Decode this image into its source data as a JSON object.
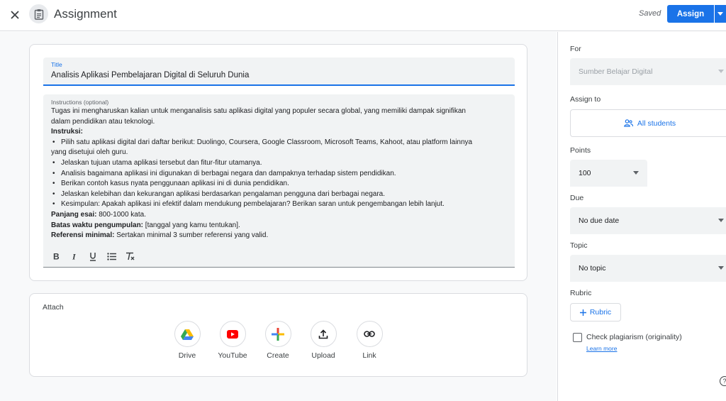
{
  "header": {
    "title": "Assignment",
    "saved_text": "Saved",
    "assign_label": "Assign"
  },
  "form": {
    "title_label": "Title",
    "title_value": "Analisis Aplikasi Pembelajaran Digital di Seluruh Dunia",
    "instructions_label": "Instructions (optional)",
    "intro_line1": "Tugas ini mengharuskan kalian untuk menganalisis satu aplikasi digital yang populer secara global, yang memiliki dampak signifikan",
    "intro_line2": "dalam pendidikan atau teknologi.",
    "instruksi_heading": "Instruksi:",
    "bullets": [
      "Pilih satu aplikasi digital dari daftar berikut: Duolingo, Coursera, Google Classroom, Microsoft Teams, Kahoot, atau platform lainnya",
      "yang disetujui oleh guru.",
      "Jelaskan tujuan utama aplikasi tersebut dan fitur-fitur utamanya.",
      "Analisis bagaimana aplikasi ini digunakan di berbagai negara dan dampaknya terhadap sistem pendidikan.",
      "Berikan contoh kasus nyata penggunaan aplikasi ini di dunia pendidikan.",
      "Jelaskan kelebihan dan kekurangan aplikasi berdasarkan pengalaman pengguna dari berbagai negara.",
      "Kesimpulan: Apakah aplikasi ini efektif dalam mendukung pembelajaran? Berikan saran untuk pengembangan lebih lanjut."
    ],
    "essay_label": "Panjang esai:",
    "essay_value": " 800-1000 kata.",
    "deadline_label": "Batas waktu pengumpulan:",
    "deadline_value": " [tanggal yang kamu tentukan].",
    "ref_label": "Referensi minimal:",
    "ref_value": " Sertakan minimal 3 sumber referensi yang valid."
  },
  "attach": {
    "label": "Attach",
    "items": [
      "Drive",
      "YouTube",
      "Create",
      "Upload",
      "Link"
    ]
  },
  "side": {
    "for_label": "For",
    "for_value": "Sumber Belajar Digital",
    "assign_to_label": "Assign to",
    "students_value": "All students",
    "points_label": "Points",
    "points_value": "100",
    "due_label": "Due",
    "due_value": "No due date",
    "topic_label": "Topic",
    "topic_value": "No topic",
    "rubric_label": "Rubric",
    "rubric_button": "Rubric",
    "plagiarism_label": "Check plagiarism (originality)",
    "learn_more": "Learn more"
  },
  "colors": {
    "accent": "#1a73e8",
    "youtube": "#ff0000"
  }
}
